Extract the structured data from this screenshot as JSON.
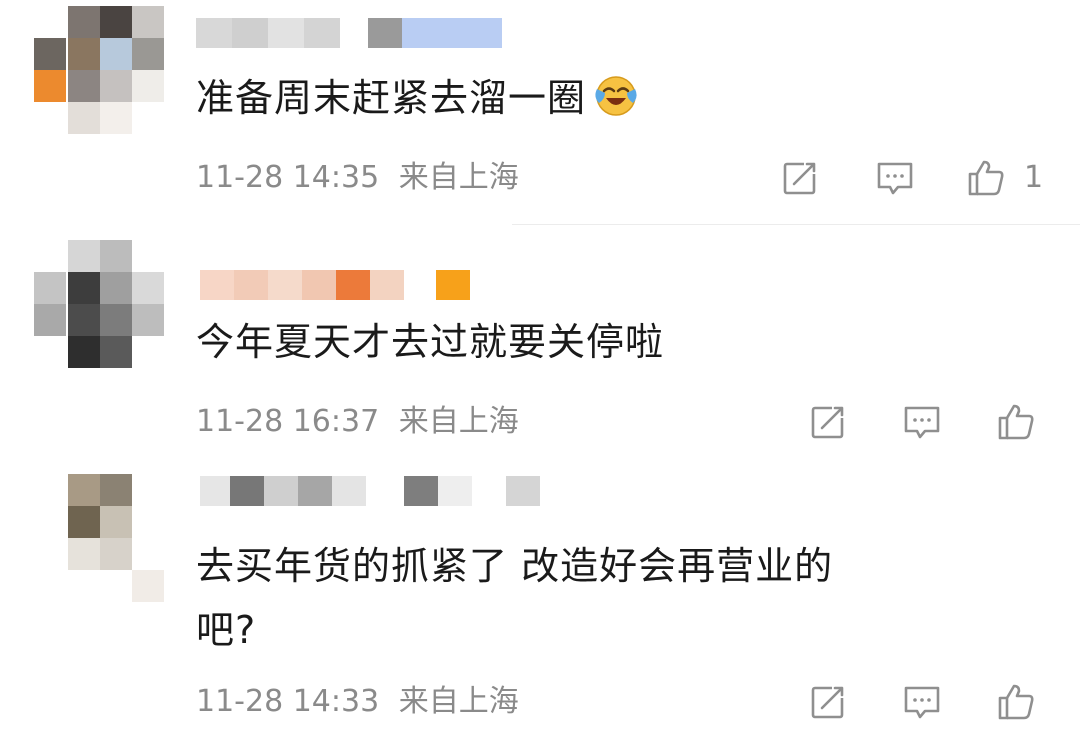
{
  "comments": [
    {
      "text": "准备周末赶紧去溜一圈",
      "emoji": "laughing-crying-emoji",
      "time": "11-28 14:35",
      "location": "来自上海",
      "likes": "1"
    },
    {
      "text": "今年夏天才去过就要关停啦",
      "time": "11-28 16:37",
      "location": "来自上海",
      "likes": ""
    },
    {
      "text_line1": "去买年货的抓紧了 改造好会再营业的",
      "text_line2": "吧?",
      "time": "11-28 14:33",
      "location": "来自上海",
      "likes": ""
    }
  ],
  "icons": {
    "share": "share-edit-icon",
    "comment": "comment-icon",
    "like": "thumbs-up-icon"
  },
  "colors": {
    "meta_text": "#8a8a8a",
    "icon_stroke": "#8f8f8f",
    "emoji_yellow": "#f6c242",
    "tear_blue": "#5aa9e6"
  }
}
